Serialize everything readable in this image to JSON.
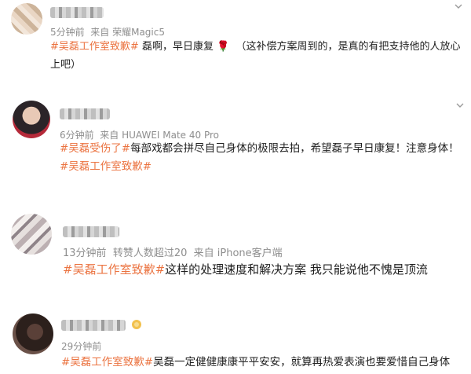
{
  "comments": [
    {
      "time": "5分钟前",
      "source": "来自 荣耀Magic5",
      "tag": "#吴磊工作室致歉#",
      "body": "磊啊，早日康复",
      "emoji": "🌹",
      "body2": "（这补偿方案周到的，是真的有把支持他的人放心上吧）"
    },
    {
      "time": "6分钟前",
      "source": "来自 HUAWEI Mate 40 Pro",
      "tag": "#吴磊受伤了#",
      "body": "每部戏都会拼尽自己身体的极限去拍，希望磊子早日康复！注意身体！",
      "tag2": "#吴磊工作室致歉#"
    },
    {
      "time": "13分钟前",
      "extra": "转赞人数超过20",
      "source": "来自 iPhone客户端",
      "tag": "#吴磊工作室致歉#",
      "body": "这样的处理速度和解决方案 我只能说他不愧是顶流"
    },
    {
      "time": "29分钟前",
      "tag": "#吴磊工作室致歉#",
      "body": "吴磊一定健健康康平平安安，就算再热爱表演也要爱惜自己身体"
    }
  ],
  "icons": {
    "more": "chevron-down-icon",
    "badge": "medal-icon"
  },
  "colors": {
    "tag": "#eb7340",
    "meta": "#8e8e8e",
    "text": "#1f1f1f"
  }
}
